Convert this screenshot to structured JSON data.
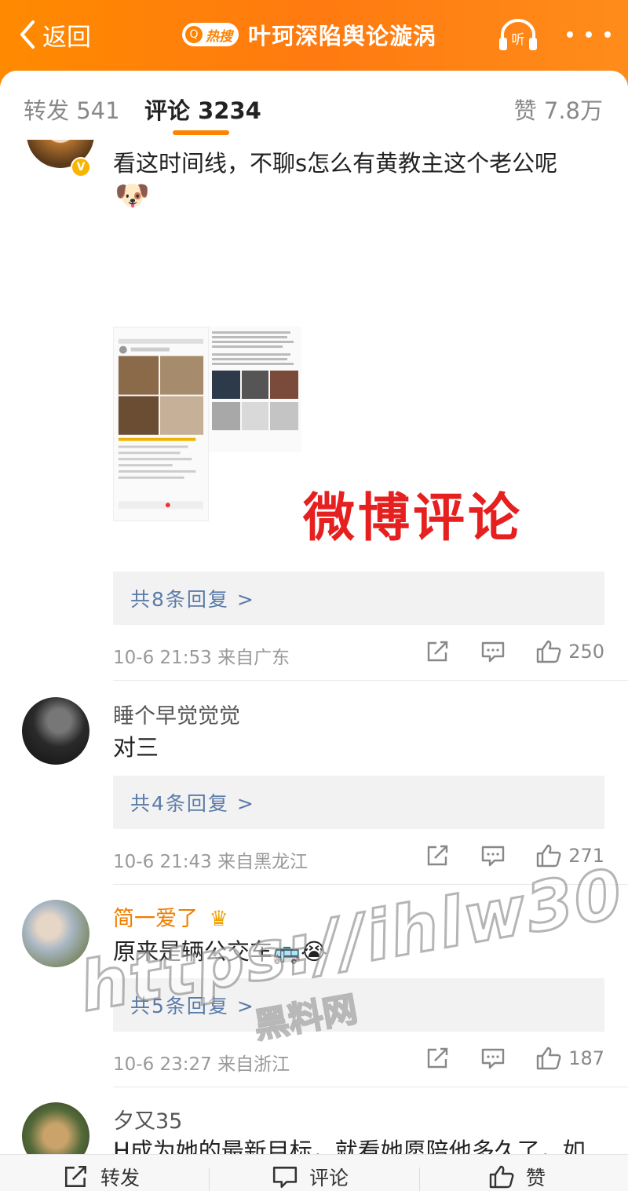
{
  "header": {
    "back_label": "返回",
    "hot_badge": "热搜",
    "title": "叶珂深陷舆论漩涡",
    "listen_label": "听",
    "accent": "#ff8200"
  },
  "tabs": {
    "forward": "转发 541",
    "comment": "评论 3234",
    "like": "赞 7.8万"
  },
  "comments": [
    {
      "name": "",
      "text": "看这时间线，不聊s怎么有黄教主这个老公呢",
      "emoji": "🐶",
      "image_overlay_text": "微博评论",
      "replies": "共8条回复 >",
      "time_location": "10-6 21:53  来自广东",
      "likes": "250"
    },
    {
      "name": "睡个早觉觉觉",
      "text": "对三",
      "replies": "共4条回复 >",
      "time_location": "10-6 21:43  来自黑龙江",
      "likes": "271"
    },
    {
      "name": "简一爱了",
      "text": "原来是辆公交车",
      "emoji": "🚌😭",
      "replies": "共5条回复 >",
      "time_location": "10-6 23:27  来自浙江",
      "likes": "187"
    },
    {
      "name": "夕又35",
      "text": "H成为她的最新目标，就看她愿陪他多久了，如果有更高一级的目标出现，估计也是前夫哥的命运",
      "replies": "",
      "time_location": "",
      "likes": ""
    }
  ],
  "bottom": {
    "forward": "转发",
    "comment": "评论",
    "like": "赞"
  },
  "watermark": {
    "url": "https://ihlw30.com",
    "sub": "黑料网"
  },
  "icons": [
    "chevron-left-icon",
    "hot-search-icon",
    "headphones-icon",
    "more-icon",
    "share-icon",
    "comment-icon",
    "thumbs-up-icon",
    "crown-icon",
    "verified-icon"
  ]
}
